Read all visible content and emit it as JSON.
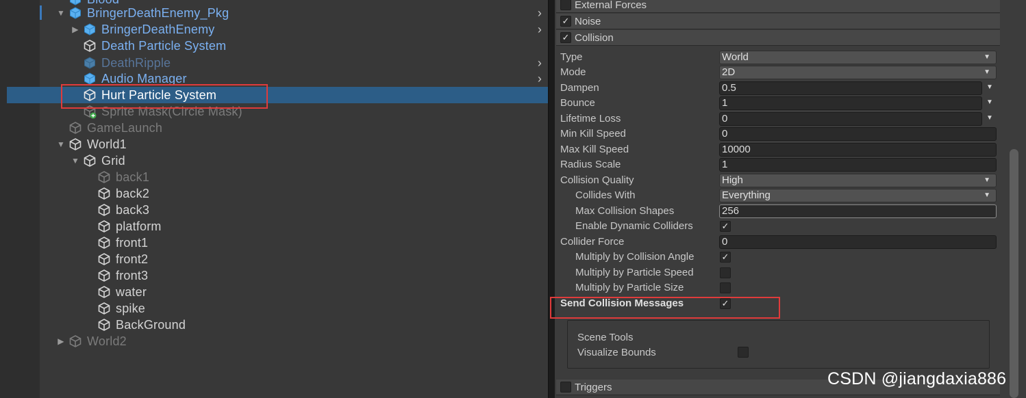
{
  "hierarchy": {
    "items": [
      {
        "label": "Blood",
        "color": "prefab",
        "icon": "prefab-cube-icon"
      },
      {
        "label": "BringerDeathEnemy_Pkg",
        "color": "prefab",
        "icon": "prefab-cube-icon",
        "expanded": true
      },
      {
        "label": "BringerDeathEnemy",
        "color": "prefab",
        "icon": "prefab-cube-icon",
        "expanded": false
      },
      {
        "label": "Death Particle System",
        "color": "prefab",
        "icon": "gameobject-cube-icon"
      },
      {
        "label": "DeathRipple",
        "color": "prefab-dim",
        "icon": "prefab-cube-icon"
      },
      {
        "label": "Audio Manager",
        "color": "prefab",
        "icon": "prefab-cube-icon"
      },
      {
        "label": "Hurt Particle System",
        "color": "selected",
        "icon": "gameobject-cube-icon"
      },
      {
        "label": "Sprite Mask(Circle Mask)",
        "color": "dim",
        "icon": "gameobject-cube-added-icon"
      },
      {
        "label": "GameLaunch",
        "color": "dim",
        "icon": "gameobject-cube-icon"
      },
      {
        "label": "World1",
        "color": "normal",
        "icon": "gameobject-cube-icon",
        "expanded": true
      },
      {
        "label": "Grid",
        "color": "normal",
        "icon": "gameobject-cube-icon",
        "expanded": true
      },
      {
        "label": "back1",
        "color": "dim",
        "icon": "gameobject-cube-icon"
      },
      {
        "label": "back2",
        "color": "normal",
        "icon": "gameobject-cube-icon"
      },
      {
        "label": "back3",
        "color": "normal",
        "icon": "gameobject-cube-icon"
      },
      {
        "label": "platform",
        "color": "normal",
        "icon": "gameobject-cube-icon"
      },
      {
        "label": "front1",
        "color": "normal",
        "icon": "gameobject-cube-icon"
      },
      {
        "label": "front2",
        "color": "normal",
        "icon": "gameobject-cube-icon"
      },
      {
        "label": "front3",
        "color": "normal",
        "icon": "gameobject-cube-icon"
      },
      {
        "label": "water",
        "color": "normal",
        "icon": "gameobject-cube-icon"
      },
      {
        "label": "spike",
        "color": "normal",
        "icon": "gameobject-cube-icon"
      },
      {
        "label": "BackGround",
        "color": "normal",
        "icon": "gameobject-cube-icon"
      },
      {
        "label": "World2",
        "color": "dim",
        "icon": "gameobject-cube-icon",
        "expanded": false
      }
    ]
  },
  "inspector": {
    "modules": {
      "external_forces": {
        "label": "External Forces",
        "checked": false
      },
      "noise": {
        "label": "Noise",
        "checked": true
      },
      "collision": {
        "label": "Collision",
        "checked": true
      },
      "triggers": {
        "label": "Triggers",
        "checked": false
      }
    },
    "collision": {
      "type": {
        "label": "Type",
        "value": "World"
      },
      "mode": {
        "label": "Mode",
        "value": "2D"
      },
      "dampen": {
        "label": "Dampen",
        "value": "0.5"
      },
      "bounce": {
        "label": "Bounce",
        "value": "1"
      },
      "lifetime_loss": {
        "label": "Lifetime Loss",
        "value": "0"
      },
      "min_kill_speed": {
        "label": "Min Kill Speed",
        "value": "0"
      },
      "max_kill_speed": {
        "label": "Max Kill Speed",
        "value": "10000"
      },
      "radius_scale": {
        "label": "Radius Scale",
        "value": "1"
      },
      "collision_quality": {
        "label": "Collision Quality",
        "value": "High"
      },
      "collides_with": {
        "label": "Collides With",
        "value": "Everything"
      },
      "max_collision_shapes": {
        "label": "Max Collision Shapes",
        "value": "256"
      },
      "enable_dynamic_colliders": {
        "label": "Enable Dynamic Colliders",
        "checked": true
      },
      "collider_force": {
        "label": "Collider Force",
        "value": "0"
      },
      "multiply_by_collision_angle": {
        "label": "Multiply by Collision Angle",
        "checked": true
      },
      "multiply_by_particle_speed": {
        "label": "Multiply by Particle Speed",
        "checked": false
      },
      "multiply_by_particle_size": {
        "label": "Multiply by Particle Size",
        "checked": false
      },
      "send_collision_messages": {
        "label": "Send Collision Messages",
        "checked": true
      }
    },
    "scene_tools": {
      "title": "Scene Tools",
      "visualize_bounds": {
        "label": "Visualize Bounds",
        "checked": false
      }
    }
  },
  "watermark": "CSDN @jiangdaxia886",
  "colors": {
    "selection": "#2c5d87",
    "prefab_text": "#7bb1f2",
    "highlight_box": "#e03b3b"
  }
}
